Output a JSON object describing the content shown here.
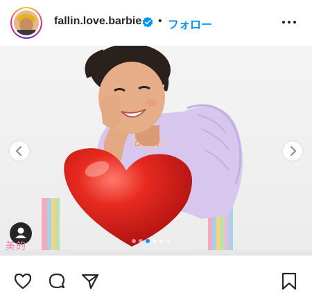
{
  "post": {
    "username": "fallin.love.barbie",
    "separator": "•",
    "follow_label": "フォロー",
    "verified": true
  },
  "media": {
    "watermark": "美的",
    "carousel": {
      "count": 6,
      "active_index": 2
    }
  },
  "icons": {
    "more": "more-horizontal-icon",
    "prev": "chevron-left-icon",
    "next": "chevron-right-icon",
    "tag": "user-tag-icon",
    "like": "heart-outline-icon",
    "comment": "comment-icon",
    "share": "paper-plane-icon",
    "save": "bookmark-icon"
  },
  "colors": {
    "accent": "#0095f6",
    "text": "#262626",
    "balloon": "#e0201b",
    "blouse": "#d7c6ee"
  }
}
